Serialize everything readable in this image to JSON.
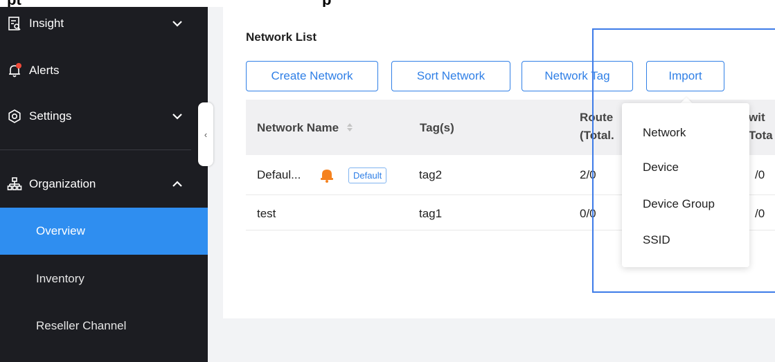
{
  "sidebar": {
    "items": [
      {
        "label": "Insight",
        "icon": "insight-icon",
        "expanded": false
      },
      {
        "label": "Alerts",
        "icon": "bell-icon",
        "has_notification": true
      },
      {
        "label": "Settings",
        "icon": "gear-icon",
        "expanded": false
      },
      {
        "label": "Organization",
        "icon": "org-tree-icon",
        "expanded": true
      }
    ],
    "sub_items": [
      {
        "label": "Overview",
        "active": true
      },
      {
        "label": "Inventory",
        "active": false
      },
      {
        "label": "Reseller Channel",
        "active": false
      }
    ],
    "collapse_glyph": "‹"
  },
  "main": {
    "title": "Network List",
    "buttons": {
      "create": "Create Network",
      "sort": "Sort Network",
      "tag": "Network Tag",
      "import": "Import"
    },
    "table": {
      "headers": {
        "name": "Network Name",
        "tags": "Tag(s)",
        "routers_line1": "Route",
        "routers_line2": "(Total.",
        "switches_line1": "wit",
        "switches_line2": "Tota"
      },
      "rows": [
        {
          "name": "Defaul...",
          "alert": true,
          "badge": "Default",
          "tag": "tag2",
          "routers": "2/0",
          "switches": "/0"
        },
        {
          "name": "test",
          "alert": false,
          "badge": "",
          "tag": "tag1",
          "routers": "0/0",
          "switches": "/0"
        }
      ]
    }
  },
  "import_menu": {
    "items": [
      "Network",
      "Device",
      "Device Group",
      "SSID"
    ]
  },
  "colors": {
    "sidebar_bg": "#1c1d22",
    "active_item": "#2f8ef0",
    "accent": "#2f7fe6",
    "alert_orange": "#f5821f",
    "notification_red": "#f04b3a",
    "annotation_blue": "#3d7be8"
  }
}
